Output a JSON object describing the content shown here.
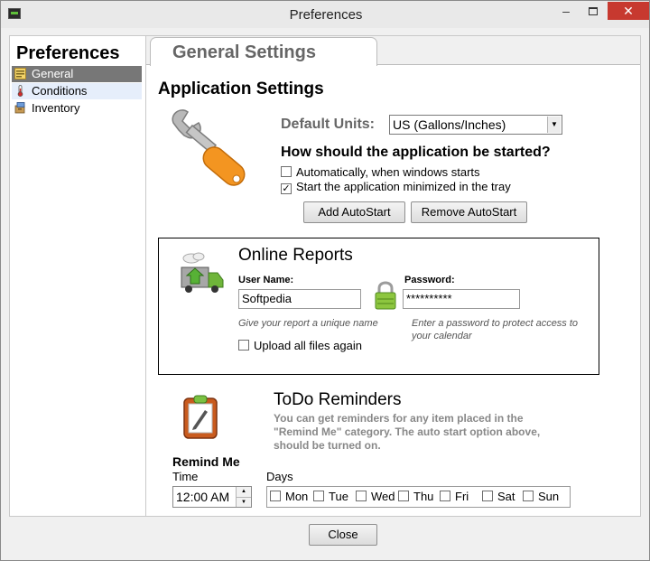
{
  "window": {
    "title": "Preferences",
    "minimize": "–",
    "close": "✕"
  },
  "sidebar": {
    "title": "Preferences",
    "items": [
      {
        "label": "General",
        "icon": "general-icon"
      },
      {
        "label": "Conditions",
        "icon": "thermometer-icon"
      },
      {
        "label": "Inventory",
        "icon": "inventory-icon"
      }
    ]
  },
  "tab": {
    "label": "General Settings"
  },
  "application": {
    "title": "Application Settings",
    "units_label": "Default Units:",
    "units_value": "US (Gallons/Inches)",
    "start_question": "How should the application be started?",
    "auto_start_label": "Automatically, when windows starts",
    "auto_start_checked": false,
    "minimized_label": "Start the application minimized in the tray",
    "minimized_checked": true,
    "minimized_mark": "✓",
    "add_autostart": "Add AutoStart",
    "remove_autostart": "Remove AutoStart"
  },
  "online_reports": {
    "title": "Online Reports",
    "username_label": "User Name:",
    "username_value": "Softpedia",
    "password_label": "Password:",
    "password_value": "**********",
    "username_hint": "Give your report a unique name",
    "password_hint": "Enter a password to protect access to your calendar",
    "upload_label": "Upload all files again"
  },
  "todo": {
    "title": "ToDo Reminders",
    "description": "You can get reminders for any item placed in the \"Remind Me\" category. The auto start option above, should be turned on.",
    "remind_label": "Remind Me",
    "time_label": "Time",
    "time_value": "12:00 AM",
    "days_label": "Days",
    "days": [
      "Mon",
      "Tue",
      "Wed",
      "Thu",
      "Fri",
      "Sat",
      "Sun"
    ]
  },
  "footer": {
    "close_label": "Close"
  },
  "colors": {
    "selected_bg": "#777777",
    "wrench_orange": "#f0901a",
    "close_red": "#c7392f"
  }
}
